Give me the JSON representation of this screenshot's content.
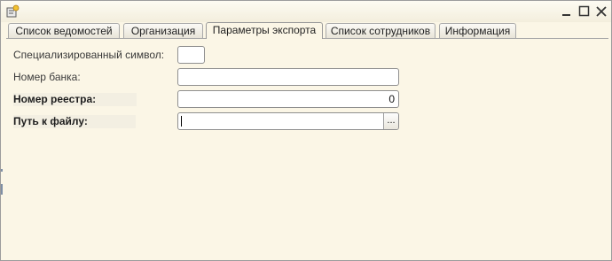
{
  "window": {
    "icons": {
      "app": "app-form-icon",
      "minimize": "minimize-icon",
      "maximize": "maximize-icon",
      "close": "close-icon"
    },
    "window_controls": [
      "minimize",
      "maximize",
      "close"
    ]
  },
  "tabs": [
    {
      "label": "Список ведомостей",
      "active": false
    },
    {
      "label": "Организация",
      "active": false
    },
    {
      "label": "Параметры экспорта",
      "active": true
    },
    {
      "label": "Список сотрудников",
      "active": false
    },
    {
      "label": "Информация",
      "active": false
    }
  ],
  "form": {
    "special_symbol": {
      "label": "Специализированный символ:",
      "value": ""
    },
    "bank_number": {
      "label": "Номер банка:",
      "value": ""
    },
    "registry_number": {
      "label": "Номер реестра:",
      "value": "0"
    },
    "file_path": {
      "label": "Путь к файлу:",
      "value": "",
      "button_label": "..."
    }
  },
  "colors": {
    "form_background": "#fbf6e6",
    "field_background": "#ffffff",
    "field_border": "#8f8f8f"
  }
}
